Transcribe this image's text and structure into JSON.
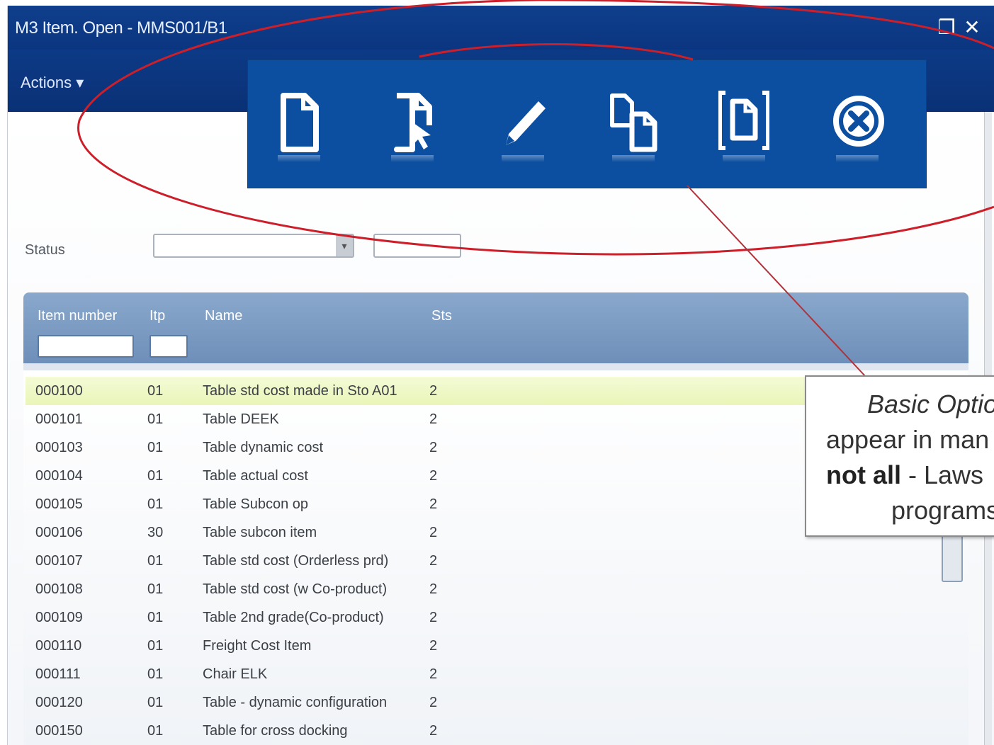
{
  "window": {
    "title": "M3 Item. Open - MMS001/B1",
    "minimize_glyph": "❐",
    "close_glyph": "✕"
  },
  "menubar": {
    "actions_label": "Actions ▾"
  },
  "filters": {
    "status_label": "Status"
  },
  "grid": {
    "columns": [
      "Item number",
      "Itp",
      "Name",
      "Sts"
    ],
    "rows": [
      {
        "item": "000100",
        "facility": "01",
        "name": "Table std cost made in Sto A01",
        "sts": "2"
      },
      {
        "item": "000101",
        "facility": "01",
        "name": "Table DEEK",
        "sts": "2"
      },
      {
        "item": "000103",
        "facility": "01",
        "name": "Table dynamic cost",
        "sts": "2"
      },
      {
        "item": "000104",
        "facility": "01",
        "name": "Table actual cost",
        "sts": "2"
      },
      {
        "item": "000105",
        "facility": "01",
        "name": "Table Subcon op",
        "sts": "2"
      },
      {
        "item": "000106",
        "facility": "30",
        "name": "Table subcon item",
        "sts": "2"
      },
      {
        "item": "000107",
        "facility": "01",
        "name": "Table std cost (Orderless prd)",
        "sts": "2"
      },
      {
        "item": "000108",
        "facility": "01",
        "name": "Table std cost (w Co-product)",
        "sts": "2"
      },
      {
        "item": "000109",
        "facility": "01",
        "name": "Table 2nd grade(Co-product)",
        "sts": "2"
      },
      {
        "item": "000110",
        "facility": "01",
        "name": "Freight Cost Item",
        "sts": "2"
      },
      {
        "item": "000111",
        "facility": "01",
        "name": "Chair ELK",
        "sts": "2"
      },
      {
        "item": "000120",
        "facility": "01",
        "name": "Table - dynamic configuration",
        "sts": "2"
      },
      {
        "item": "000150",
        "facility": "01",
        "name": "Table for cross docking",
        "sts": "2"
      }
    ],
    "selected_index": 0
  },
  "toolbar": {
    "buttons": [
      {
        "icon": "new-document-icon"
      },
      {
        "icon": "open-document-icon"
      },
      {
        "icon": "edit-pencil-icon"
      },
      {
        "icon": "copy-document-icon"
      },
      {
        "icon": "display-document-icon"
      },
      {
        "icon": "delete-circle-icon"
      }
    ]
  },
  "callout": {
    "line1": "Basic Optio",
    "line2": "appear in man",
    "line3_bold": "not all",
    "line3_rest": " - Laws",
    "line4": "programs"
  },
  "colors": {
    "titlebar": "#0f3f8c",
    "toolbar": "#0c4ea0",
    "highlight_ellipse": "#cc1f2a",
    "selected_row": "#e9f5b8",
    "grid_header": "#7a9ac2"
  }
}
